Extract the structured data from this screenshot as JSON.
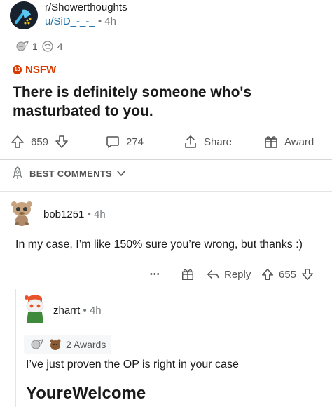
{
  "post": {
    "subreddit": "r/Showerthoughts",
    "author": "u/SiD_-_-_",
    "time": "4h",
    "awards_count": "1",
    "comments_preview_count": "4",
    "nsfw_label": "NSFW",
    "nsfw_badge": "18",
    "title": "There is definitely someone who's masturbated to you."
  },
  "actions": {
    "upvotes": "659",
    "comments": "274",
    "share": "Share",
    "award": "Award"
  },
  "sort": {
    "label": "BEST COMMENTS"
  },
  "comments": [
    {
      "username": "bob1251",
      "time": "4h",
      "body": "In my case, I’m like 150% sure you’re wrong, but thanks :)",
      "reply_label": "Reply",
      "score": "655",
      "more": "•••"
    },
    {
      "username": "zharrt",
      "time": "4h",
      "awards": "2 Awards",
      "body_line1": "I’ve just proven the OP is right in your case",
      "body_line2": "YoureWelcome"
    }
  ],
  "colors": {
    "nsfw": "#d93a00",
    "link": "#1a73a9",
    "muted": "#787c7e",
    "divider": "#d7d7d7"
  }
}
